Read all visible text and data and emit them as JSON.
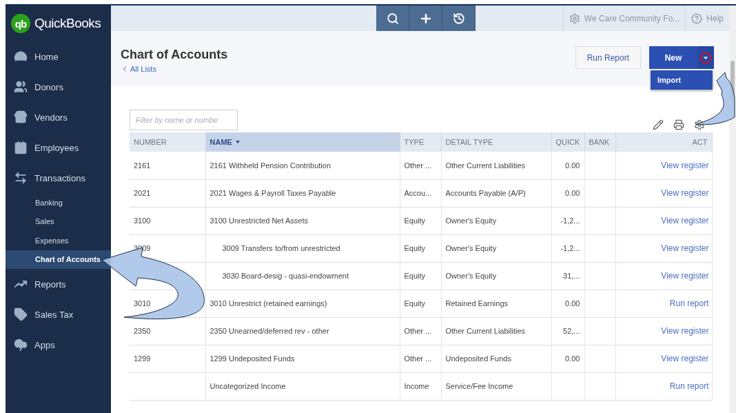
{
  "app": {
    "logo": "qb",
    "name": "QuickBooks"
  },
  "sidebar": {
    "items": [
      {
        "label": "Home",
        "kind": "main",
        "selected": false
      },
      {
        "label": "Donors",
        "kind": "main",
        "selected": false
      },
      {
        "label": "Vendors",
        "kind": "main",
        "selected": false
      },
      {
        "label": "Employees",
        "kind": "main",
        "selected": false
      },
      {
        "label": "Transactions",
        "kind": "main",
        "selected": false
      },
      {
        "label": "Banking",
        "kind": "sub",
        "selected": false
      },
      {
        "label": "Sales",
        "kind": "sub",
        "selected": false
      },
      {
        "label": "Expenses",
        "kind": "sub",
        "selected": false
      },
      {
        "label": "Chart of Accounts",
        "kind": "sub",
        "selected": true
      },
      {
        "label": "Reports",
        "kind": "main",
        "selected": false
      },
      {
        "label": "Sales Tax",
        "kind": "main",
        "selected": false
      },
      {
        "label": "Apps",
        "kind": "main",
        "selected": false
      }
    ]
  },
  "topbar": {
    "company": "We Care Community Fo...",
    "help": "Help"
  },
  "page": {
    "title": "Chart of Accounts",
    "back_link": "All Lists",
    "run_report": "Run Report",
    "new": "New",
    "menu": [
      "Import"
    ]
  },
  "filter": {
    "placeholder": "Filter by name or numbe"
  },
  "table": {
    "columns": [
      {
        "label": "NUMBER",
        "sorted": false
      },
      {
        "label": "NAME",
        "sorted": true
      },
      {
        "label": "TYPE",
        "sorted": false
      },
      {
        "label": "DETAIL TYPE",
        "sorted": false
      },
      {
        "label": "QUICK",
        "sorted": false
      },
      {
        "label": "BANK",
        "sorted": false
      },
      {
        "label": "ACT",
        "sorted": false
      }
    ],
    "rows": [
      {
        "number": "2161",
        "name": "2161 Withheld Pension Contribution",
        "type": "Other ...",
        "detail_type": "Other Current Liabilities",
        "quick": "0.00",
        "action": "View register"
      },
      {
        "number": "2021",
        "name": "2021 Wages & Payroll Taxes Payable",
        "type": "Accou...",
        "detail_type": "Accounts Payable (A/P)",
        "quick": "0.00",
        "action": "View register"
      },
      {
        "number": "3100",
        "name": "3100 Unrestricted Net Assets",
        "type": "Equity",
        "detail_type": "Owner's Equity",
        "quick": "-1,2...",
        "action": "View register",
        "children": [
          {
            "number": "3009",
            "name": "3009 Transfers to/from unrestricted",
            "type": "Equity",
            "detail_type": "Owner's Equity",
            "quick": "-1,2...",
            "action": "View register"
          },
          {
            "name": "3030 Board-desig - quasi-endowment",
            "type": "Equity",
            "detail_type": "Owner's Equity",
            "quick": "31,...",
            "action": "View register"
          }
        ]
      },
      {
        "number": "3010",
        "name": "3010 Unrestrict (retained earnings)",
        "type": "Equity",
        "detail_type": "Retained Earnings",
        "quick": "0.00",
        "action": "Run report"
      },
      {
        "number": "2350",
        "name": "2350 Unearned/deferred rev - other",
        "type": "Other ...",
        "detail_type": "Other Current Liabilities",
        "quick": "52,...",
        "action": "View register"
      },
      {
        "number": "1299",
        "name": "1299 Undeposited Funds",
        "type": "Other ...",
        "detail_type": "Undeposited Funds",
        "quick": "0.00",
        "action": "View register"
      },
      {
        "number": "",
        "name": "Uncategorized Income",
        "type": "Income",
        "detail_type": "Service/Fee Income",
        "quick": "",
        "action": "Run report"
      }
    ]
  }
}
